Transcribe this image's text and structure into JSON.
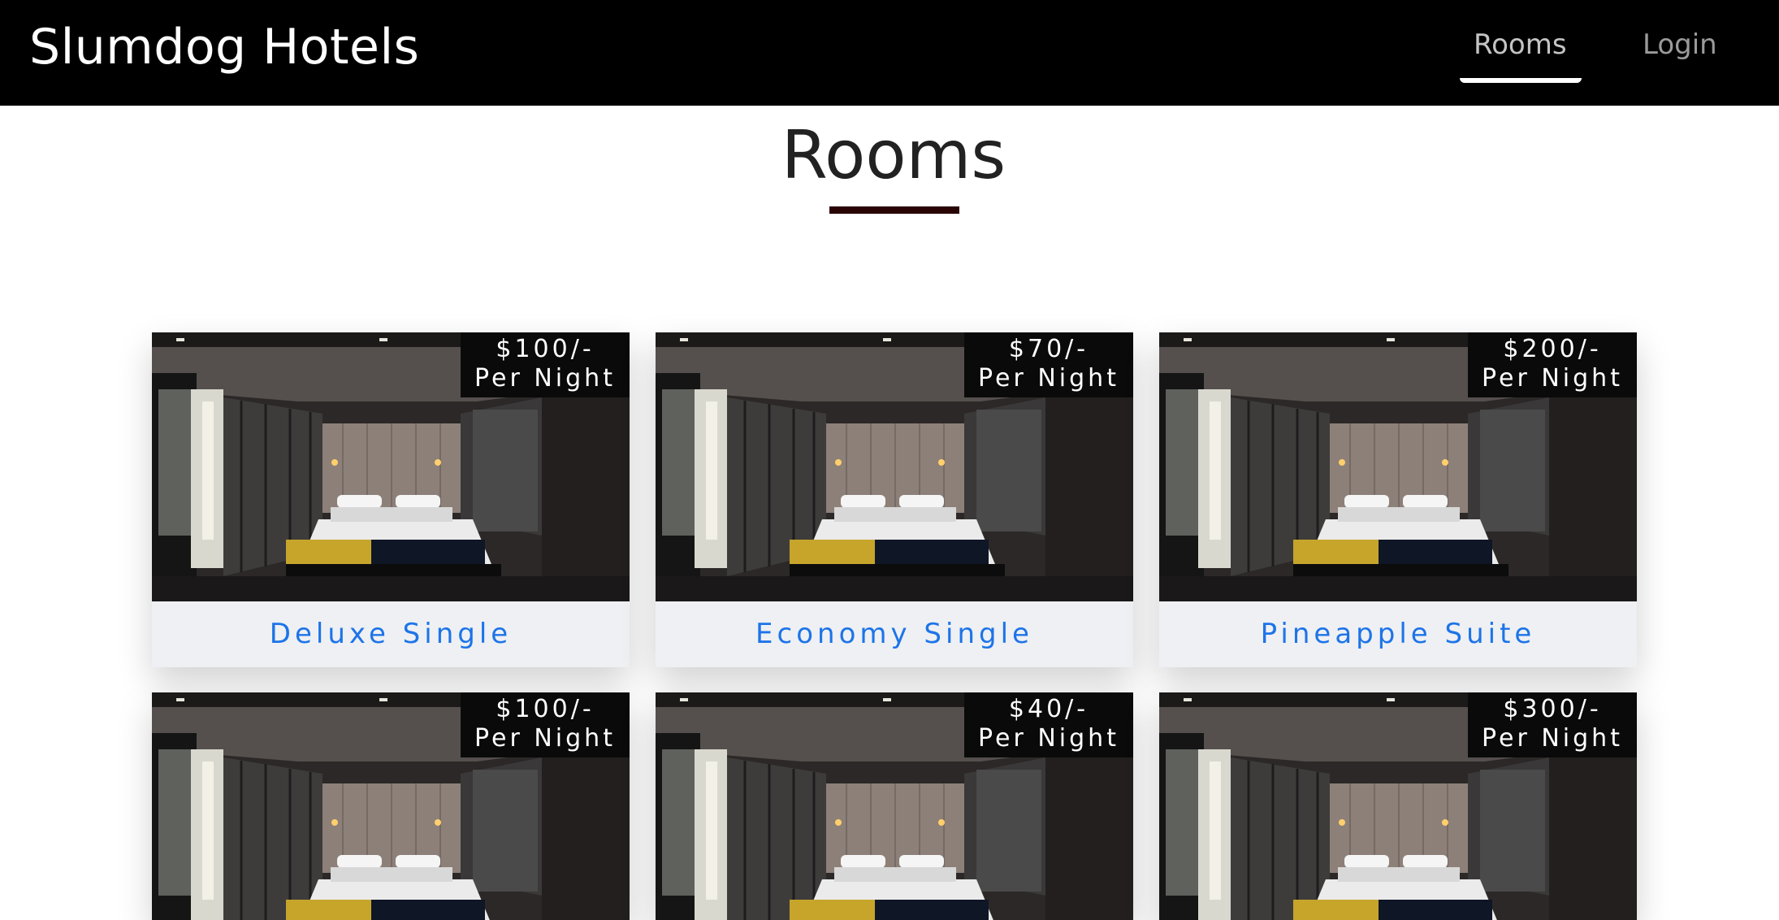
{
  "navbar": {
    "brand": "Slumdog Hotels",
    "links": [
      {
        "label": "Rooms",
        "active": true
      },
      {
        "label": "Login",
        "active": false
      }
    ]
  },
  "page": {
    "title": "Rooms"
  },
  "rooms": [
    {
      "name": "Deluxe Single",
      "price": "$100/-",
      "unit": "Per Night"
    },
    {
      "name": "Economy Single",
      "price": "$70/-",
      "unit": "Per Night"
    },
    {
      "name": "Pineapple Suite",
      "price": "$200/-",
      "unit": "Per Night"
    },
    {
      "name": "",
      "price": "$100/-",
      "unit": "Per Night"
    },
    {
      "name": "",
      "price": "$40/-",
      "unit": "Per Night"
    },
    {
      "name": "",
      "price": "$300/-",
      "unit": "Per Night"
    }
  ],
  "colors": {
    "navbar_bg": "#000000",
    "title_underline": "#2a0404",
    "room_link": "#1d74e8",
    "badge_bg": "#0a0a0a"
  }
}
